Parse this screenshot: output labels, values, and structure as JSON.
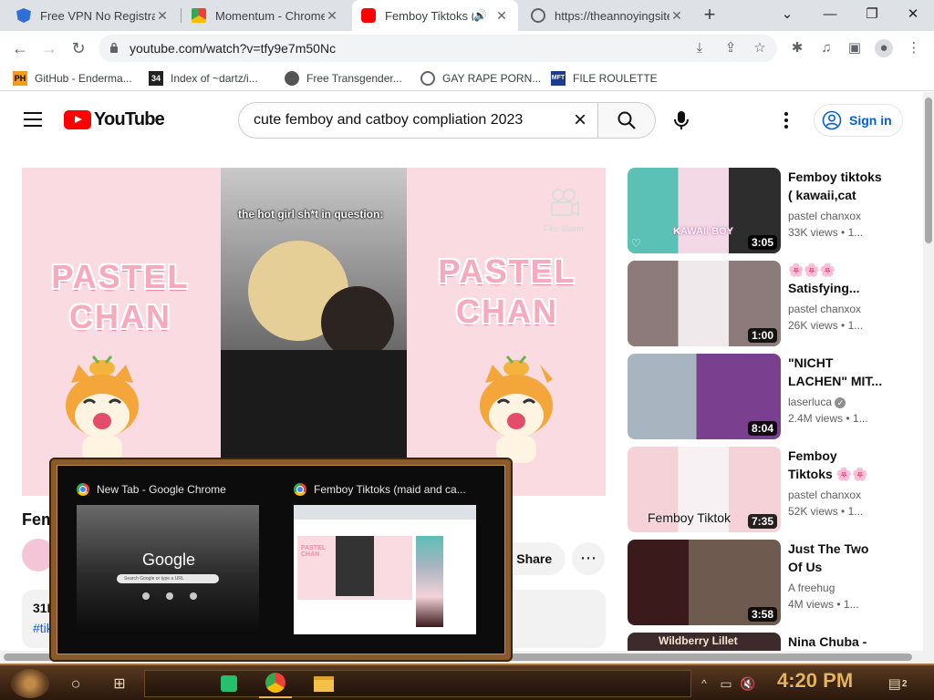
{
  "browser": {
    "tabs": [
      {
        "label": "Free VPN No Registration",
        "active": false
      },
      {
        "label": "Momentum - Chrome Web Store",
        "active": false
      },
      {
        "label": "Femboy Tiktoks (",
        "active": true
      },
      {
        "label": "https://theannoyingsite.com",
        "active": false
      }
    ],
    "url": "youtube.com/watch?v=tfy9e7m50Nc",
    "bookmarks": [
      {
        "label": "GitHub - Enderma...",
        "icon": "PH"
      },
      {
        "label": "Index of ~dartz/i...",
        "icon": "34"
      },
      {
        "label": "Free Transgender...",
        "icon": ""
      },
      {
        "label": "GAY RAPE PORN...",
        "icon": ""
      },
      {
        "label": "FILE ROULETTE",
        "icon": "MFT"
      }
    ]
  },
  "youtube": {
    "logo": "YouTube",
    "search_query": "cute femboy and catboy compliation 2023",
    "signin_label": "Sign in",
    "video": {
      "caption": "the hot girl sh*t in question:",
      "brand_left_1": "PASTEL",
      "brand_left_2": "CHAN",
      "brand_right_1": "PASTEL",
      "brand_right_2": "CHAN",
      "watermark": "Film Maker",
      "title": "Fem",
      "share_label": "Share",
      "views_short": "31K",
      "hashtag_short": "#tik"
    },
    "recommendations": [
      {
        "title": "Femboy tiktoks ( kawaii,cat an...",
        "channel": "pastel chanxox",
        "views": "33K views",
        "age": "• 1...",
        "duration": "3:05",
        "overlay": "KAWAII BOY"
      },
      {
        "title": "🌸🌸🌸 Satisfying...",
        "channel": "pastel chanxox",
        "views": "26K views",
        "age": "• 1...",
        "duration": "1:00",
        "overlay": ""
      },
      {
        "title": "\"NICHT LACHEN\" MIT...",
        "channel": "laserluca",
        "views": "2.4M views",
        "age": "• 1...",
        "duration": "8:04",
        "overlay": ""
      },
      {
        "title": "Femboy Tiktoks 🌸🌸🌸",
        "channel": "pastel chanxox",
        "views": "52K views",
        "age": "• 1...",
        "duration": "7:35",
        "overlay": "Femboy Tiktok"
      },
      {
        "title": "Just The Two Of Us",
        "channel": "A freehug",
        "views": "4M views",
        "age": "• 1...",
        "duration": "3:58",
        "overlay": ""
      },
      {
        "title": "Nina Chuba -",
        "channel": "",
        "views": "",
        "age": "",
        "duration": "",
        "overlay": "Wildberry Lillet"
      }
    ]
  },
  "switcher": {
    "items": [
      {
        "label": "New Tab - Google Chrome",
        "thumb_word": "Google",
        "thumb_search": "Search Google or type a URL"
      },
      {
        "label": "Femboy Tiktoks (maid and ca...",
        "thumb_word": "PASTEL CHAN",
        "thumb_search": ""
      }
    ]
  },
  "taskbar": {
    "clock": "4:20 PM",
    "notifications": "2"
  },
  "colors": {
    "youtube_red": "#ff0000",
    "link_blue": "#065fd4",
    "pastel_pink": "#f7a9bd",
    "taskbar_brown": "#3b2414",
    "clock_gold": "#e8b45a"
  }
}
